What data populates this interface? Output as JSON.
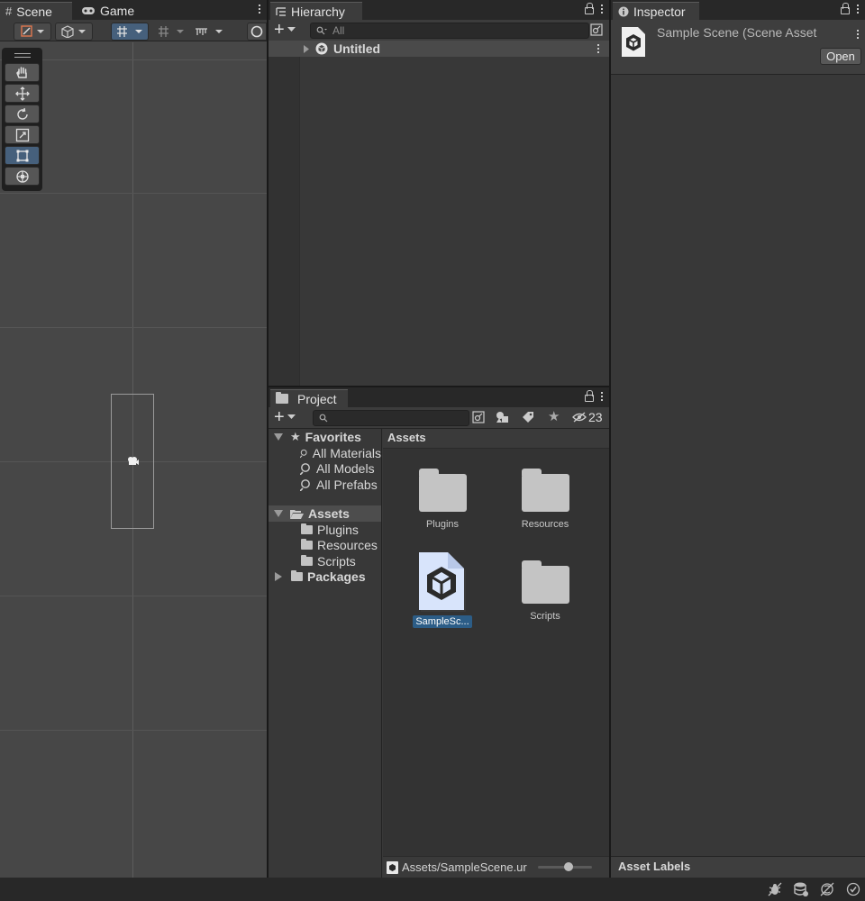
{
  "scene_panel": {
    "tabs": [
      {
        "label": "Scene"
      },
      {
        "label": "Game"
      }
    ],
    "tools": [
      "hand-tool",
      "move-tool",
      "rotate-tool",
      "scale-tool",
      "rect-tool",
      "transform-tool"
    ],
    "active_tool": "rect-tool"
  },
  "hierarchy": {
    "tab_label": "Hierarchy",
    "add_label": "+",
    "search_placeholder": "All",
    "root_item": "Untitled"
  },
  "project": {
    "tab_label": "Project",
    "add_label": "+",
    "hidden_count": "23",
    "favorites_label": "Favorites",
    "favorites": [
      "All Materials",
      "All Models",
      "All Prefabs"
    ],
    "assets_label": "Assets",
    "asset_folders": [
      "Plugins",
      "Resources",
      "Scripts"
    ],
    "packages_label": "Packages",
    "breadcrumb": "Assets",
    "grid_items": [
      {
        "label": "Plugins",
        "type": "folder"
      },
      {
        "label": "Resources",
        "type": "folder"
      },
      {
        "label": "SampleSc...",
        "type": "scene",
        "selected": true
      },
      {
        "label": "Scripts",
        "type": "folder"
      }
    ],
    "footer_path": "Assets/SampleScene.ur"
  },
  "inspector": {
    "tab_label": "Inspector",
    "title": "Sample Scene (Scene Asset",
    "open_button": "Open",
    "asset_labels": "Asset Labels"
  },
  "colors": {
    "panel_bg": "#383838",
    "tab_bg": "#282828",
    "selection": "#2c5d87",
    "active_tool": "#46607c"
  }
}
